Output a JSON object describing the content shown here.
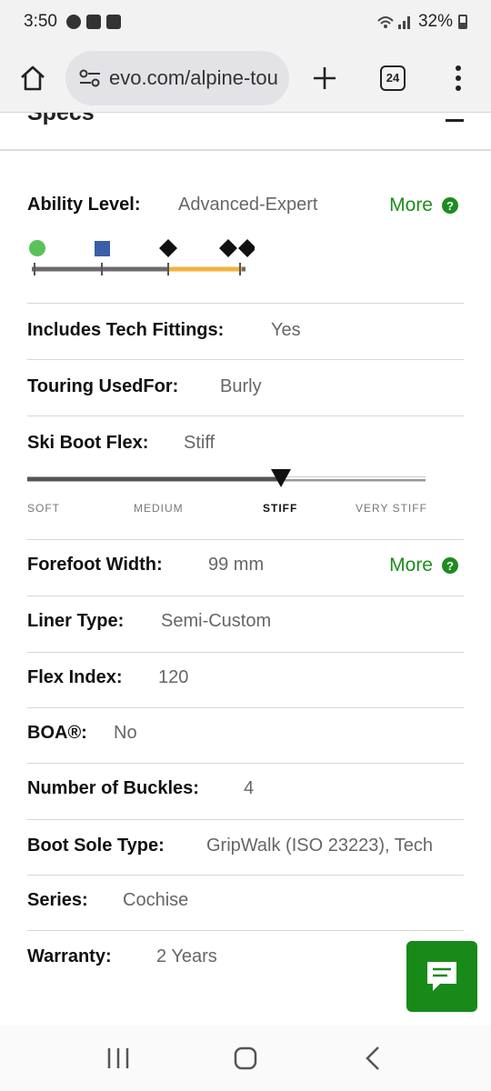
{
  "status_bar": {
    "time": "3:50",
    "battery": "32%"
  },
  "browser": {
    "url": "evo.com/alpine-touring",
    "tab_count": "24"
  },
  "specs": {
    "title": "Specs",
    "ability_level": {
      "label": "Ability Level:",
      "value": "Advanced-Expert",
      "more": "More",
      "help": "?"
    },
    "tech_fittings": {
      "label": "Includes Tech Fittings:",
      "value": "Yes"
    },
    "touring_used_for": {
      "label": "Touring UsedFor:",
      "value": "Burly"
    },
    "ski_boot_flex": {
      "label": "Ski Boot Flex:",
      "value": "Stiff",
      "scale": [
        "SOFT",
        "MEDIUM",
        "STIFF",
        "VERY STIFF"
      ],
      "selected_index": 2
    },
    "forefoot_width": {
      "label": "Forefoot Width:",
      "value": "99 mm",
      "more": "More",
      "help": "?"
    },
    "liner_type": {
      "label": "Liner Type:",
      "value": "Semi-Custom"
    },
    "flex_index": {
      "label": "Flex Index:",
      "value": "120"
    },
    "boa": {
      "label": "BOA®:",
      "value": "No"
    },
    "buckles": {
      "label": "Number of Buckles:",
      "value": "4"
    },
    "sole_type": {
      "label": "Boot Sole Type:",
      "value": "GripWalk (ISO 23223), Tech"
    },
    "series": {
      "label": "Series:",
      "value": "Cochise"
    },
    "warranty": {
      "label": "Warranty:",
      "value": "2 Years"
    }
  },
  "colors": {
    "accent_green": "#1e8c1e",
    "chat_green": "#178a1a",
    "range_orange": "#f2b33d",
    "blue_square": "#3a5ea8"
  }
}
